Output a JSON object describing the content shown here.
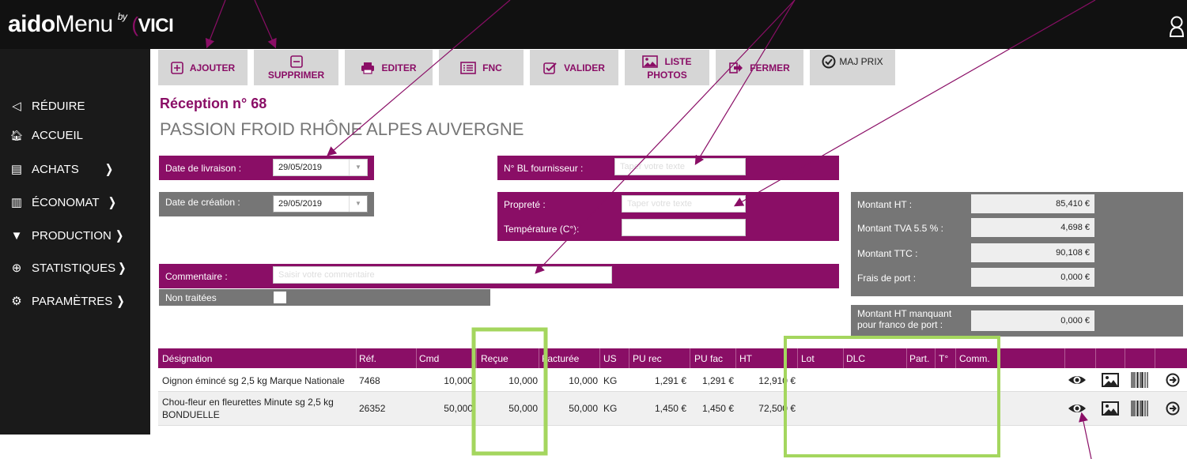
{
  "app": {
    "logo_bold": "aido",
    "logo_light": "Menu",
    "logo_by": "by",
    "logo_brand": "VICI"
  },
  "toolbar": {
    "ajouter": "AJOUTER",
    "supprimer": "SUPPRIMER",
    "editer": "EDITER",
    "fnc": "FNC",
    "valider": "VALIDER",
    "liste": "LISTE",
    "photos": "PHOTOS",
    "fermer": "FERMER",
    "maj_prix": "MAJ PRIX"
  },
  "sidebar": {
    "items": [
      {
        "label": "RÉDUIRE",
        "icon": "chevron-left-icon"
      },
      {
        "label": "ACCUEIL",
        "icon": "home-icon"
      },
      {
        "label": "ACHATS",
        "icon": "list-icon",
        "arrow": "❭"
      },
      {
        "label": "ÉCONOMAT",
        "icon": "bar-chart-icon",
        "arrow": "❭"
      },
      {
        "label": "PRODUCTION",
        "icon": "triangle-down-icon",
        "arrow": "❭"
      },
      {
        "label": "STATISTIQUES",
        "icon": "globe-icon",
        "arrow": "❭"
      },
      {
        "label": "PARAMÈTRES",
        "icon": "gears-icon",
        "arrow": "❭"
      }
    ]
  },
  "page": {
    "title": "Réception n° 68",
    "supplier": "PASSION FROID RHÔNE ALPES AUVERGNE"
  },
  "form": {
    "date_livraison_label": "Date de livraison :",
    "date_livraison_value": "29/05/2019",
    "date_creation_label": "Date de création :",
    "date_creation_value": "29/05/2019",
    "bl_label": "N° BL fournisseur :",
    "bl_placeholder": "Taper votre texte",
    "proprete_label": "Propreté :",
    "proprete_placeholder": "Taper votre texte",
    "temperature_label": "Température (C°):",
    "temperature_value": "",
    "commentaire_label": "Commentaire :",
    "commentaire_placeholder": "Saisir votre commentaire",
    "non_traitees_label": "Non traitées"
  },
  "totals": {
    "montant_ht_label": "Montant HT :",
    "montant_ht": "85,410 €",
    "tva_label": "Montant TVA 5.5 % :",
    "tva": "4,698 €",
    "ttc_label": "Montant TTC :",
    "ttc": "90,108 €",
    "port_label": "Frais de port :",
    "port": "0,000 €",
    "manquant_label_1": "Montant HT manquant",
    "manquant_label_2": "pour franco de port :",
    "manquant": "0,000 €"
  },
  "table": {
    "headers": {
      "designation": "Désignation",
      "ref": "Réf.",
      "cmd": "Cmd",
      "recue": "Reçue",
      "facturee": "Facturée",
      "us": "US",
      "pu_rec": "PU rec",
      "pu_fac": "PU fac",
      "ht": "HT",
      "lot": "Lot",
      "dlc": "DLC",
      "part": "Part.",
      "t": "T°",
      "comm": "Comm."
    },
    "rows": [
      {
        "designation_1": "Oignon émincé sg 2,5 kg Marque Nationale",
        "designation_2": "",
        "ref": "7468",
        "cmd": "10,000",
        "recue": "10,000",
        "facturee": "10,000",
        "us": "KG",
        "pu_rec": "1,291 €",
        "pu_fac": "1,291 €",
        "ht": "12,910 €"
      },
      {
        "designation_1": "Chou-fleur en fleurettes Minute sg 2,5 kg",
        "designation_2": "BONDUELLE",
        "ref": "26352",
        "cmd": "50,000",
        "recue": "50,000",
        "facturee": "50,000",
        "us": "KG",
        "pu_rec": "1,450 €",
        "pu_fac": "1,450 €",
        "ht": "72,500 €"
      }
    ]
  },
  "colors": {
    "brand": "#8a0e66",
    "panel_gray": "#767676",
    "sidebar": "#1a1a1a",
    "annotation_green": "#a4d65e",
    "annotation_arrow": "#8a0e66"
  }
}
